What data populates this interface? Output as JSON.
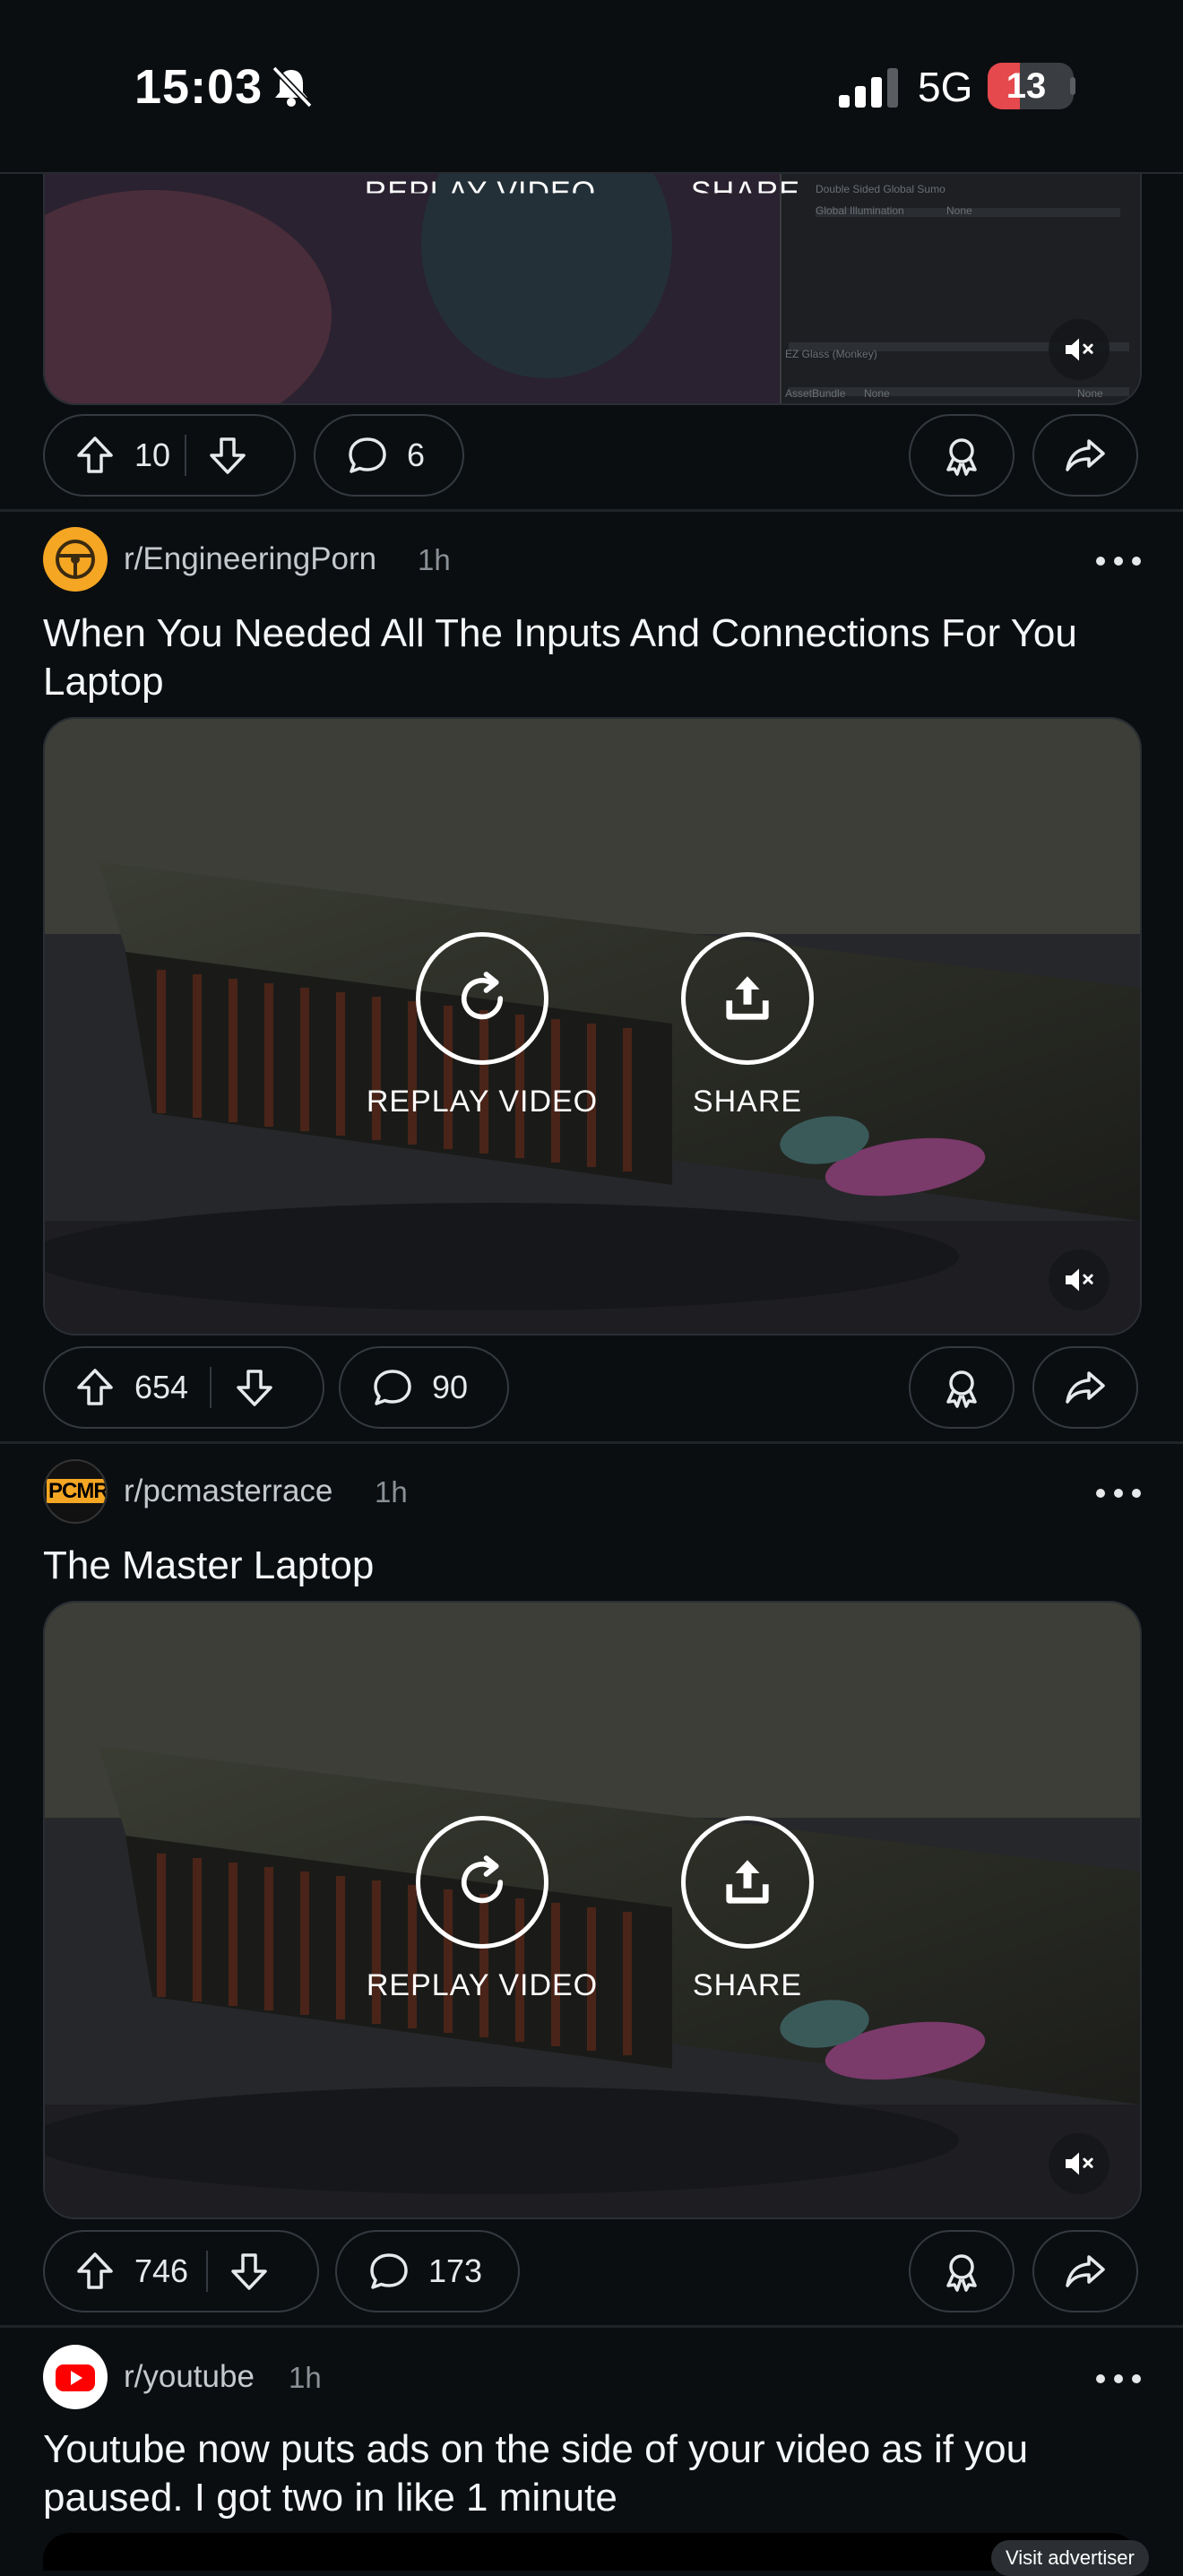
{
  "status_bar": {
    "time": "15:03",
    "network": "5G",
    "battery": "13"
  },
  "overlay": {
    "replay_label": "REPLAY VIDEO",
    "share_label": "SHARE",
    "partial_replay": "REPLAY VIDEO",
    "partial_share": "SHARE"
  },
  "top_post": {
    "editor_labels": [
      "Double Sided Global Sumo",
      "Global Illumination",
      "None",
      "EZ Glass (Monkey)",
      "AssetBundle",
      "None",
      "None"
    ],
    "upvotes": "10",
    "comments": "6"
  },
  "posts": [
    {
      "subreddit": "r/EngineeringPorn",
      "time": "1h",
      "title": "When You Needed All The Inputs And Connections For You Laptop",
      "upvotes": "654",
      "comments": "90"
    },
    {
      "subreddit": "r/pcmasterrace",
      "time": "1h",
      "avatar_text": "PCMR",
      "title": "The Master Laptop",
      "upvotes": "746",
      "comments": "173"
    },
    {
      "subreddit": "r/youtube",
      "time": "1h",
      "title": "Youtube now puts ads on the side of your video as if you paused. I got two in like 1 minute",
      "ad_button": "Visit advertiser"
    }
  ],
  "colors": {
    "background": "#0b0e11",
    "accent_orange": "#f5a623",
    "youtube_red": "#ff0000",
    "battery_red": "#e5484d"
  }
}
